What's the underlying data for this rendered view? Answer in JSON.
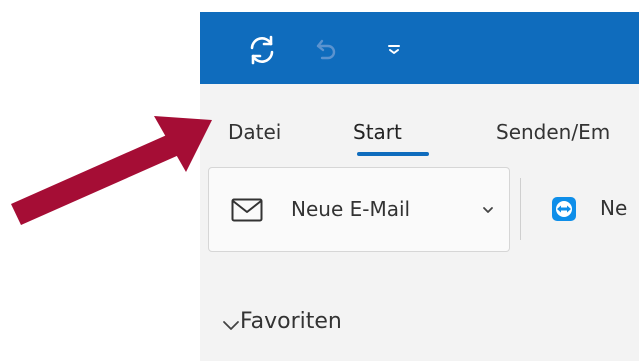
{
  "quick_access": {
    "sync_icon": "sync-icon",
    "undo_icon": "undo-icon",
    "customize_icon": "customize-qat-icon"
  },
  "tabs": [
    {
      "label": "Datei"
    },
    {
      "label": "Start",
      "active": true
    },
    {
      "label": "Senden/Em"
    }
  ],
  "ribbon": {
    "new_mail_label": "Neue E-Mail",
    "new_mail_icon": "envelope-icon",
    "dropdown_icon": "chevron-down-icon",
    "teamviewer_label": "Ne",
    "teamviewer_icon": "teamviewer-icon"
  },
  "folder_pane": {
    "favorites_label": "Favoriten",
    "favorites_icon": "chevron-down-icon"
  },
  "annotation": {
    "arrow_color": "#a50d35"
  },
  "colors": {
    "titlebar": "#0f6cbd",
    "accent": "#0f6cbd",
    "background": "#f3f3f3"
  }
}
